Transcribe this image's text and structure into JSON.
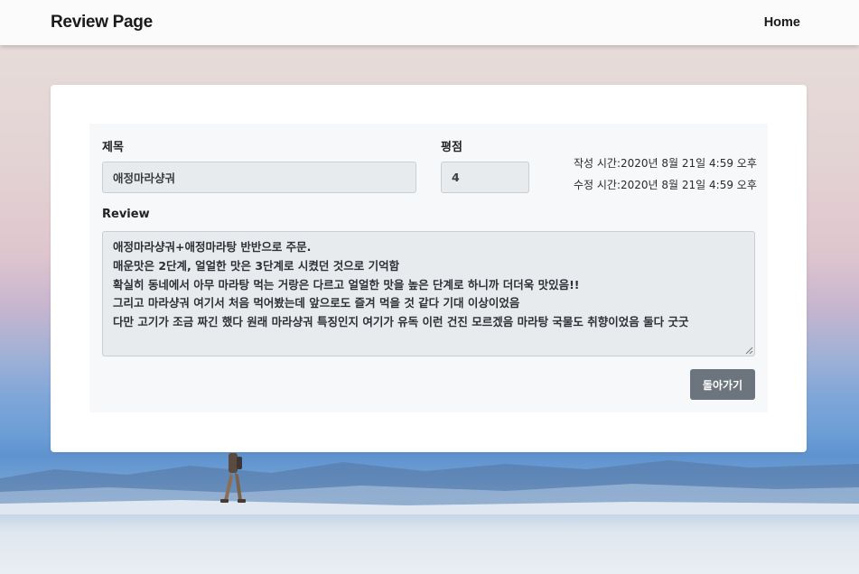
{
  "navbar": {
    "brand": "Review Page",
    "home_link": "Home"
  },
  "form": {
    "title_label": "제목",
    "title_value": "애정마라샹궈",
    "rating_label": "평점",
    "rating_value": "4",
    "created_at": "작성 시간:2020년 8월 21일 4:59 오후",
    "updated_at": "수정 시간:2020년 8월 21일 4:59 오후",
    "review_label": "Review",
    "review_lines": [
      "애정마라샹궈+애정마라탕 반반으로 주문.",
      "매운맛은 2단계, 얼얼한 맛은 3단계로 시켰던 것으로 기억함",
      "확실히 동네에서 아무 마라탕 먹는 거랑은 다르고 얼얼한 맛을 높은 단계로 하니까 더더욱 맛있음!!",
      "그리고 마라샹궈 여기서 처음 먹어봤는데 앞으로도 즐겨 먹을 것 같다 기대 이상이었음",
      "다만 고기가 조금 짜긴 했다 원래 마라샹궈 특징인지 여기가 유독 이런 건진 모르겠음 마라탕 국물도 취향이었음 둘다 굿굿"
    ],
    "back_button": "돌아가기"
  },
  "icons": {
    "resize_grip": "resize-grip-icon"
  }
}
